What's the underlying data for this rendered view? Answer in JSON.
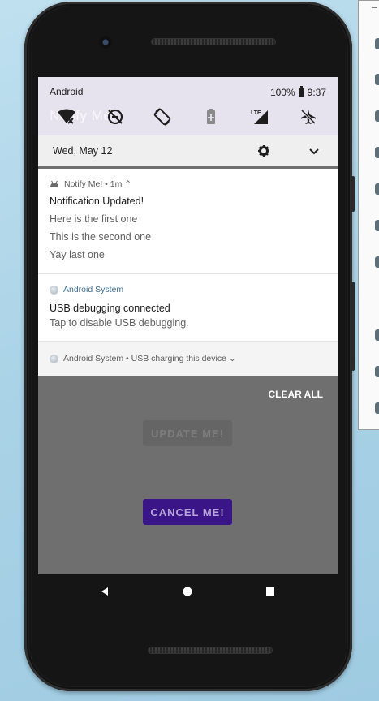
{
  "status_bar": {
    "carrier": "Android",
    "battery": "100%",
    "time": "9:37"
  },
  "app_ghost_title": "Notify Me!",
  "quick_settings_icons": [
    "wifi-off-icon",
    "dnd-off-icon",
    "auto-rotate-icon",
    "battery-saver-icon",
    "lte-signal-icon",
    "airplane-off-icon"
  ],
  "date_row": {
    "date": "Wed, May 12",
    "settings_icon": "gear-icon",
    "expand_icon": "chevron-down-icon"
  },
  "notifications": [
    {
      "app": "Notify Me! • 1m ⌃",
      "title": "Notification Updated!",
      "lines": [
        "Here is the first one",
        "This is the second one",
        "Yay last one"
      ]
    },
    {
      "app": "Android System",
      "title": "USB debugging connected",
      "lines": [
        "Tap to disable USB debugging."
      ]
    },
    {
      "app": "Android System • USB charging this device ⌄"
    }
  ],
  "clear_all": "CLEAR ALL",
  "app_buttons": {
    "update": "UPDATE ME!",
    "cancel": "CANCEL ME!"
  },
  "nav_bar": [
    "back-icon",
    "home-icon",
    "overview-icon"
  ],
  "colors": {
    "cancel_button": "#3a1588",
    "shade_background": "#e7e3ee",
    "system_app_label": "#3d6c90"
  }
}
